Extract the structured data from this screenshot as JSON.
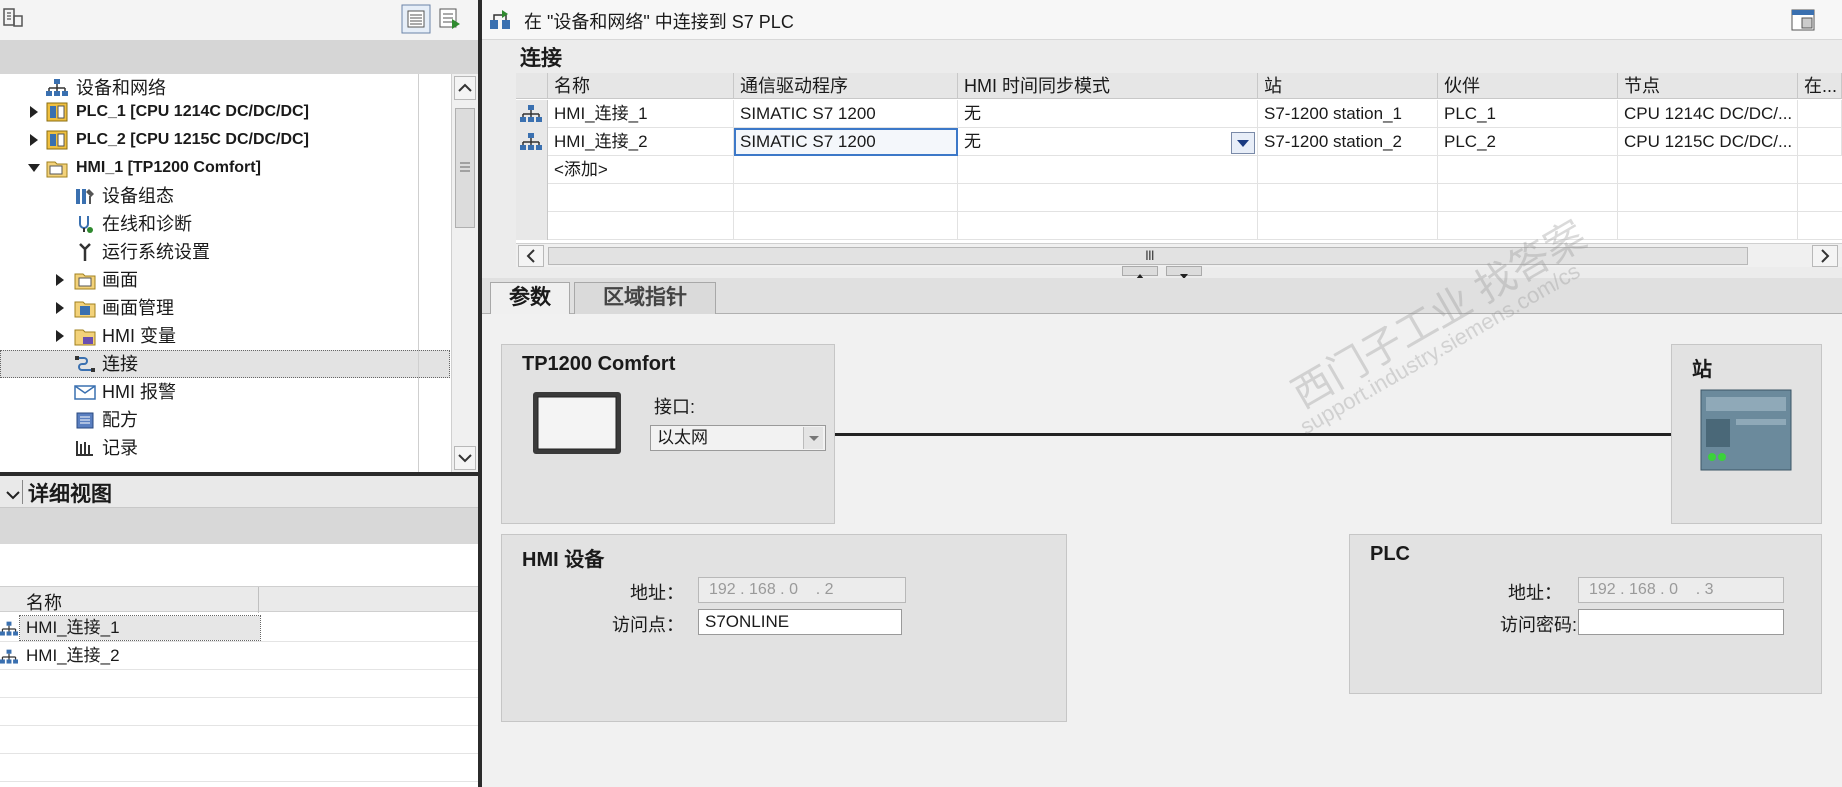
{
  "left": {
    "tree": [
      {
        "label": "设备和网络",
        "icon": "network-icon",
        "indent": 0,
        "expander": "none"
      },
      {
        "label": "PLC_1 [CPU 1214C DC/DC/DC]",
        "icon": "plc-icon",
        "indent": 0,
        "expander": "collapsed",
        "bold": true
      },
      {
        "label": "PLC_2 [CPU 1215C DC/DC/DC]",
        "icon": "plc-icon",
        "indent": 0,
        "expander": "collapsed",
        "bold": true
      },
      {
        "label": "HMI_1 [TP1200 Comfort]",
        "icon": "hmi-device-icon",
        "indent": 0,
        "expander": "expanded",
        "bold": true
      },
      {
        "label": "设备组态",
        "icon": "device-config-icon",
        "indent": 1,
        "expander": "none"
      },
      {
        "label": "在线和诊断",
        "icon": "online-diagnostics-icon",
        "indent": 1,
        "expander": "none"
      },
      {
        "label": "运行系统设置",
        "icon": "runtime-settings-icon",
        "indent": 1,
        "expander": "none"
      },
      {
        "label": "画面",
        "icon": "folder-icon",
        "indent": 1,
        "expander": "collapsed"
      },
      {
        "label": "画面管理",
        "icon": "folder-icon",
        "indent": 1,
        "expander": "collapsed"
      },
      {
        "label": "HMI 变量",
        "icon": "folder-icon",
        "indent": 1,
        "expander": "collapsed"
      },
      {
        "label": "连接",
        "icon": "connection-icon",
        "indent": 1,
        "expander": "none",
        "selected": true
      },
      {
        "label": "HMI 报警",
        "icon": "alarm-icon",
        "indent": 1,
        "expander": "none"
      },
      {
        "label": "配方",
        "icon": "recipe-icon",
        "indent": 1,
        "expander": "none"
      },
      {
        "label": "记录",
        "icon": "log-icon",
        "indent": 1,
        "expander": "none"
      }
    ],
    "detail": {
      "title": "详细视图",
      "column_name": "名称",
      "rows": [
        "HMI_连接_1",
        "HMI_连接_2"
      ]
    }
  },
  "right": {
    "title": "在 \"设备和网络\" 中连接到 S7 PLC",
    "section_title": "连接",
    "grid": {
      "columns": [
        "名称",
        "通信驱动程序",
        "HMI 时间同步模式",
        "站",
        "伙伴",
        "节点",
        "在..."
      ],
      "rows": [
        [
          "HMI_连接_1",
          "SIMATIC S7 1200",
          "无",
          "S7-1200 station_1",
          "PLC_1",
          "CPU 1214C DC/DC/...",
          ""
        ],
        [
          "HMI_连接_2",
          "SIMATIC S7 1200",
          "无",
          "S7-1200 station_2",
          "PLC_2",
          "CPU 1215C DC/DC/...",
          ""
        ]
      ],
      "add_row": "<添加>",
      "scroll_grip": "III"
    },
    "tabs": [
      "参数",
      "区域指针"
    ],
    "params": {
      "device_title": "TP1200 Comfort",
      "interface_label": "接口:",
      "interface_value": "以太网",
      "station_title": "站",
      "hmi_title": "HMI 设备",
      "hmi_address_label": "地址：",
      "hmi_address": "192 . 168 . 0    . 2",
      "hmi_access_label": "访问点：",
      "hmi_access": "S7ONLINE",
      "plc_title": "PLC",
      "plc_address_label": "地址：",
      "plc_address": "192 . 168 . 0    . 3",
      "plc_password_label": "访问密码:",
      "plc_password": ""
    },
    "watermark": {
      "line1": "西门子工业  找答案",
      "line2": "support.industry.siemens.com/cs"
    }
  },
  "colors": {
    "splitter": "#2b2b2b",
    "focus_border": "#3c78c8",
    "panel_bg": "#e2e2e2"
  }
}
